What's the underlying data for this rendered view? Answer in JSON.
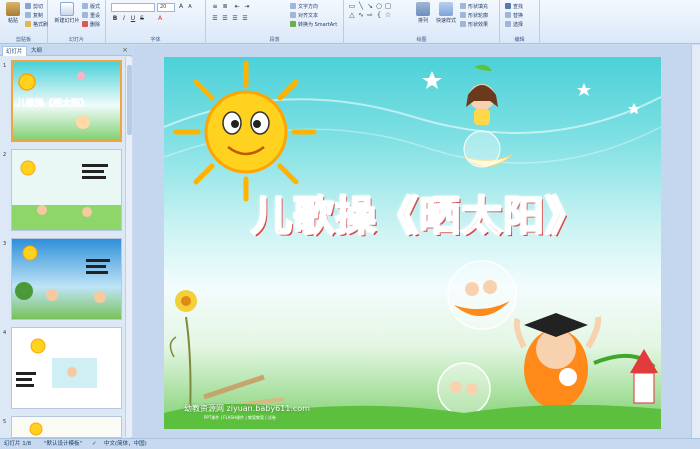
{
  "ribbon": {
    "groups": {
      "clipboard": "剪贴板",
      "slides": "幻灯片",
      "font": "字体",
      "paragraph": "段落",
      "drawing": "绘图",
      "editing": "编辑"
    },
    "clipboard": {
      "paste": "粘贴",
      "cut": "剪切",
      "copy": "复制",
      "format_painter": "格式刷"
    },
    "slides": {
      "new_slide": "新建幻灯片",
      "layout": "版式",
      "reset": "重设",
      "delete": "删除"
    },
    "font": {
      "font_name": "",
      "font_size": "20"
    },
    "paragraph": {
      "text_direction": "文字方向",
      "align_text": "对齐文本",
      "convert_smartart": "转换为 SmartArt"
    },
    "drawing": {
      "arrange": "排列",
      "quick_styles": "快速样式",
      "shape_fill": "形状填充",
      "shape_outline": "形状轮廓",
      "shape_effects": "形状效果"
    },
    "editing": {
      "find": "查找",
      "replace": "替换",
      "select": "选择"
    }
  },
  "left_pane": {
    "tab_slides": "幻灯片",
    "tab_outline": "大纲",
    "close": "×",
    "thumbnails": [
      {
        "number": "1",
        "caption": "儿歌操《晒太阳》"
      },
      {
        "number": "2",
        "caption": ""
      },
      {
        "number": "3",
        "caption": ""
      },
      {
        "number": "4",
        "caption": ""
      },
      {
        "number": "5",
        "caption": ""
      }
    ]
  },
  "slide": {
    "title": "儿歌操《晒太阳》",
    "watermark": "幼教资源网 ziyuan.baby611.com",
    "watermark_sub": "PPT课件 | FLASH课件 | 教案教案 | 试卷"
  },
  "status": {
    "slide_info": "幻灯片 1/8",
    "theme": "\"默认设计模板\"",
    "language": "中文(简体，中国)"
  },
  "colors": {
    "title_red": "#ef2a2a",
    "selection_orange": "#f0a640",
    "ribbon_blue": "#dbe8f8"
  }
}
